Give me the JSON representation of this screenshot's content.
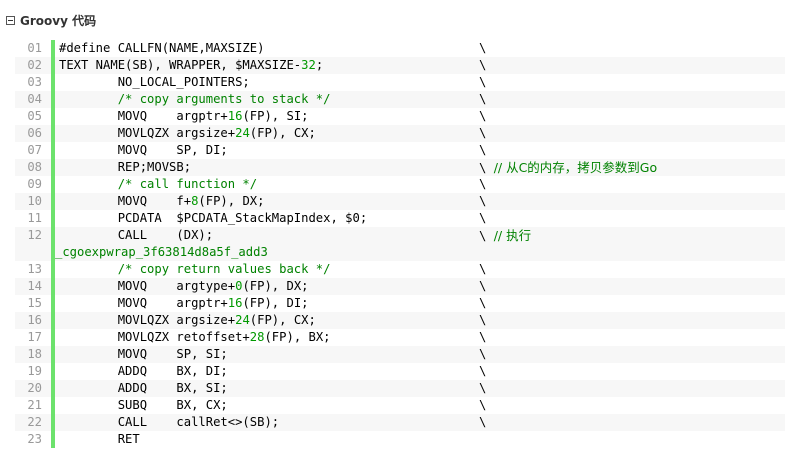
{
  "header": {
    "title": "Groovy 代码"
  },
  "code": {
    "lines": [
      {
        "no": "01",
        "text": "#define CALLFN(NAME,MAXSIZE)",
        "cont": "\\"
      },
      {
        "no": "02",
        "text": "TEXT NAME(SB), WRAPPER, $MAXSIZE-32;",
        "cont": "\\"
      },
      {
        "no": "03",
        "text": "        NO_LOCAL_POINTERS;",
        "cont": "\\"
      },
      {
        "no": "04",
        "text": "        /* copy arguments to stack */",
        "cont": "\\"
      },
      {
        "no": "05",
        "text": "        MOVQ    argptr+16(FP), SI;",
        "cont": "\\"
      },
      {
        "no": "06",
        "text": "        MOVLQZX argsize+24(FP), CX;",
        "cont": "\\"
      },
      {
        "no": "07",
        "text": "        MOVQ    SP, DI;",
        "cont": "\\"
      },
      {
        "no": "08",
        "text": "        REP;MOVSB;",
        "cont": "\\ // 从C的内存，拷贝参数到Go"
      },
      {
        "no": "09",
        "text": "        /* call function */",
        "cont": "\\"
      },
      {
        "no": "10",
        "text": "        MOVQ    f+8(FP), DX;",
        "cont": "\\"
      },
      {
        "no": "11",
        "text": "        PCDATA  $PCDATA_StackMapIndex, $0;",
        "cont": "\\"
      },
      {
        "no": "12",
        "text": "        CALL    (DX);",
        "cont": "\\ // 执行",
        "wrap": "_cgoexpwrap_3f63814d8a5f_add3"
      },
      {
        "no": "13",
        "text": "        /* copy return values back */",
        "cont": "\\"
      },
      {
        "no": "14",
        "text": "        MOVQ    argtype+0(FP), DX;",
        "cont": "\\"
      },
      {
        "no": "15",
        "text": "        MOVQ    argptr+16(FP), DI;",
        "cont": "\\"
      },
      {
        "no": "16",
        "text": "        MOVLQZX argsize+24(FP), CX;",
        "cont": "\\"
      },
      {
        "no": "17",
        "text": "        MOVLQZX retoffset+28(FP), BX;",
        "cont": "\\"
      },
      {
        "no": "18",
        "text": "        MOVQ    SP, SI;",
        "cont": "\\"
      },
      {
        "no": "19",
        "text": "        ADDQ    BX, DI;",
        "cont": "\\"
      },
      {
        "no": "20",
        "text": "        ADDQ    BX, SI;",
        "cont": "\\"
      },
      {
        "no": "21",
        "text": "        SUBQ    BX, CX;",
        "cont": "\\"
      },
      {
        "no": "22",
        "text": "        CALL    callRet<>(SB);",
        "cont": "\\"
      },
      {
        "no": "23",
        "text": "        RET",
        "cont": ""
      }
    ]
  },
  "colors": {
    "gutter_bar": "#6ce26c",
    "comment": "#008200",
    "number": "#009900",
    "line_number": "#999999"
  }
}
